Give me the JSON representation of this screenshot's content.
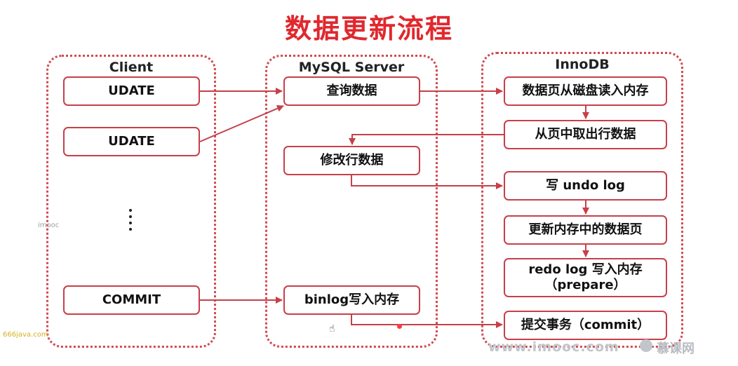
{
  "title": "数据更新流程",
  "columns": {
    "client": "Client",
    "server": "MySQL Server",
    "innodb": "InnoDB"
  },
  "client": {
    "udate1": "UDATE",
    "udate2": "UDATE",
    "commit": "COMMIT"
  },
  "server": {
    "query": "查询数据",
    "modify": "修改行数据",
    "binlog": "binlog写入内存"
  },
  "innodb": {
    "load_page": "数据页从磁盘读入内存",
    "fetch_row": "从页中取出行数据",
    "undo": "写 undo log",
    "update_page": "更新内存中的数据页",
    "redo_line1": "redo log 写入内存",
    "redo_line2": "（prepare）",
    "commit": "提交事务（commit）"
  },
  "watermarks": {
    "left": "imooc",
    "bottom_left": "666java.com",
    "bottom_right_site": "www.imooc.com",
    "bottom_right_brand": "慕课网"
  },
  "colors": {
    "title": "#e0282e",
    "line": "#c6404a",
    "dotted_border": "#d04a52"
  }
}
